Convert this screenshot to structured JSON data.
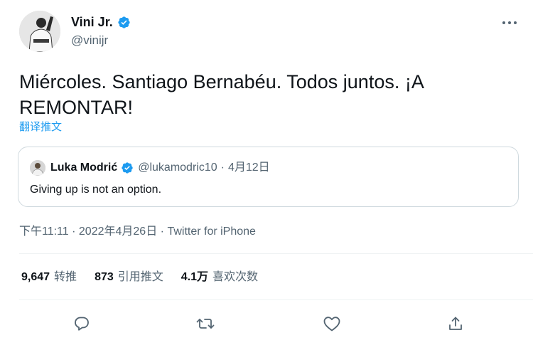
{
  "author": {
    "name": "Vini Jr.",
    "handle": "@vinijr"
  },
  "tweet": {
    "text": "Miércoles. Santiago Bernabéu. Todos juntos. ¡A\nREMONTAR!",
    "translate_label": "翻译推文"
  },
  "quote": {
    "name": "Luka Modrić",
    "handle": "@lukamodric10",
    "separator": "·",
    "date": "4月12日",
    "text": "Giving up is not an option."
  },
  "meta": {
    "time": "下午11:11",
    "separator": "·",
    "date": "2022年4月26日",
    "source": "Twitter for iPhone"
  },
  "stats": {
    "retweets_count": "9,647",
    "retweets_label": "转推",
    "quotes_count": "873",
    "quotes_label": "引用推文",
    "likes_count": "4.1万",
    "likes_label": "喜欢次数"
  },
  "actions": [
    "reply-icon",
    "retweet-icon",
    "like-icon",
    "share-icon"
  ],
  "colors": {
    "accent": "#1d9bf0",
    "text": "#0f1419",
    "secondary": "#536471",
    "border": "#cfd9de"
  }
}
